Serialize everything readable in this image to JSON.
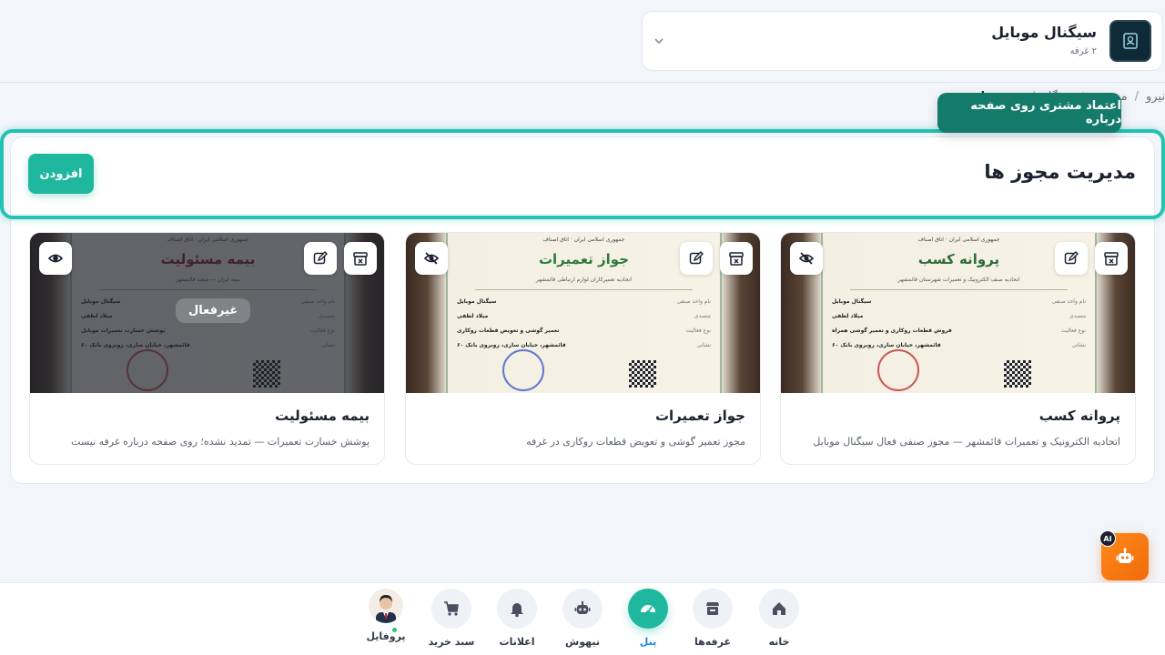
{
  "store": {
    "name": "سیگنال موبایل",
    "rooms": "۲ غرفه"
  },
  "breadcrumb": {
    "items": [
      "نیرو",
      "مدیریت فروشگاه",
      "مجوزها"
    ]
  },
  "tooltip": "اعتماد مشتری روی صفحه درباره",
  "page": {
    "title": "مدیریت مجوز ها",
    "add_label": "افزودن"
  },
  "cards": [
    {
      "title": "پروانه کسب",
      "desc": "اتحادیه الکترونیک و تعمیرات قائمشهر — مجوز صنفی فعال سیگنال موبایل",
      "cert_title": "پروانه کسب",
      "cert_head": "جمهوری اسلامی ایران · اتاق اصناف",
      "cert_sub": "اتحادیه صنف الکترونیک و تعمیرات شهرستان قائمشهر",
      "rows": [
        [
          "نام واحد صنفی",
          "سیگنال موبایل"
        ],
        [
          "متصدی",
          "میلاد لطفی"
        ],
        [
          "نوع فعالیت",
          "فروش قطعات روکاری و تعمیر گوشی همراه"
        ],
        [
          "نشانی",
          "قائمشهر، خیابان ساری، روبروی بانک ۶۰"
        ]
      ],
      "title_color": "#2d6b3a",
      "visibility_icon": "eye-off-icon",
      "inactive": false
    },
    {
      "title": "جواز تعمیرات",
      "desc": "مجوز تعمیر گوشی و تعویض قطعات روکاری در غرفه",
      "cert_title": "جواز تعمیرات",
      "cert_head": "جمهوری اسلامی ایران · اتاق اصناف",
      "cert_sub": "اتحادیه تعمیرکاران لوازم ارتباطی قائمشهر",
      "rows": [
        [
          "نام واحد صنفی",
          "سیگنال موبایل"
        ],
        [
          "متصدی",
          "میلاد لطفی"
        ],
        [
          "نوع فعالیت",
          "تعمیر گوشی و تعویض قطعات روکاری"
        ],
        [
          "نشانی",
          "قائمشهر، خیابان ساری، روبروی بانک ۶۰"
        ]
      ],
      "title_color": "#2d7a3a",
      "visibility_icon": "eye-off-icon",
      "inactive": false
    },
    {
      "title": "بیمه مسئولیت",
      "desc": "پوشش خسارت تعمیرات — تمدید نشده؛ روی صفحه درباره غرفه نیست",
      "cert_title": "بیمه مسئولیت",
      "cert_head": "جمهوری اسلامی ایران · اتاق اصناف",
      "cert_sub": "بیمه ایران — شعبه قائمشهر",
      "rows": [
        [
          "نام واحد صنفی",
          "سیگنال موبایل"
        ],
        [
          "متصدی",
          "میلاد لطفی"
        ],
        [
          "نوع فعالیت",
          "پوشش خسارت تعمیرات موبایل"
        ],
        [
          "نشانی",
          "قائمشهر، خیابان ساری، روبروی بانک ۶۰"
        ]
      ],
      "title_color": "#8a1f2a",
      "visibility_icon": "eye-icon",
      "inactive": true,
      "inactive_label": "غیرفعال"
    }
  ],
  "nav": [
    {
      "label": "خانه",
      "icon": "home-icon"
    },
    {
      "label": "غرفه‌ها",
      "icon": "store-icon"
    },
    {
      "label": "پنل",
      "icon": "dashboard-icon",
      "active": true
    },
    {
      "label": "نیهوش",
      "icon": "robot-icon"
    },
    {
      "label": "اعلانات",
      "icon": "bell-icon"
    },
    {
      "label": "سبد خرید",
      "icon": "cart-icon"
    },
    {
      "label": "پروفایل",
      "icon": "avatar"
    }
  ],
  "ai_fab": {
    "badge": "AI",
    "icon": "robot-icon"
  },
  "colors": {
    "accent": "#1fb89f",
    "highlight": "#23c2b2",
    "tooltip": "#147a6a",
    "fab": "#f57a12",
    "nav_active_label": "#1f8bd6"
  }
}
